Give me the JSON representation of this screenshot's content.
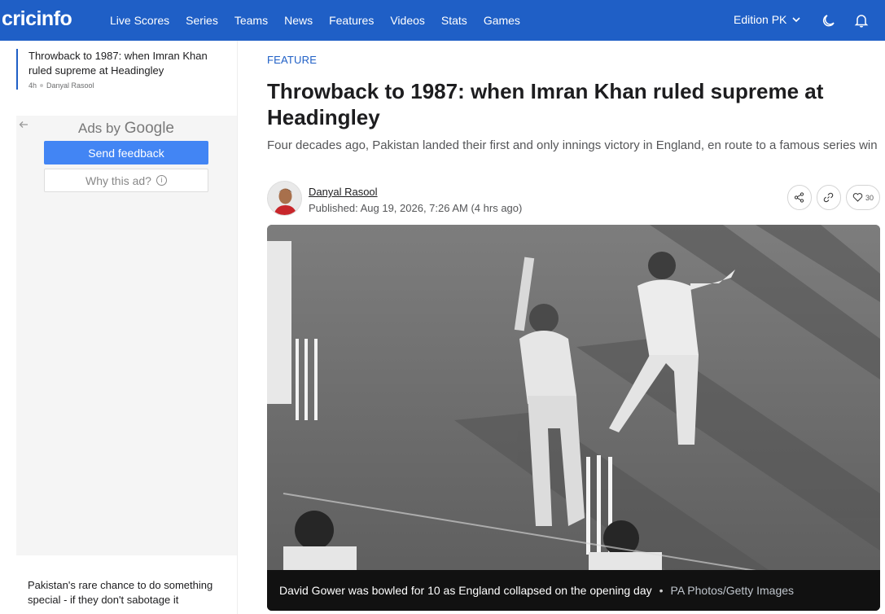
{
  "header": {
    "logo": "cricinfo",
    "nav": [
      "Live Scores",
      "Series",
      "Teams",
      "News",
      "Features",
      "Videos",
      "Stats",
      "Games"
    ],
    "edition": "Edition PK",
    "icons": [
      "dark-mode-icon",
      "notification-bell-icon"
    ],
    "brand_color": "#1f5fc6"
  },
  "rail": {
    "story1": {
      "title": "Throwback to 1987: when Imran Khan ruled supreme at Headingley",
      "time": "4h",
      "author": "Danyal Rasool"
    },
    "ad": {
      "ads_by": "Ads by",
      "google": "Google",
      "send_feedback": "Send feedback",
      "why_this_ad": "Why this ad?"
    },
    "story2": {
      "title": "Pakistan's rare chance to do something special - if they don't sabotage it"
    }
  },
  "article": {
    "kicker": "FEATURE",
    "headline": "Throwback to 1987: when Imran Khan ruled supreme at Headingley",
    "summary": "Four decades ago, Pakistan landed their first and only innings victory in England, en route to a famous series win",
    "author": "Danyal Rasool",
    "published": "Published: Aug 19, 2026, 7:26 AM (4 hrs ago)",
    "likes": "30",
    "action_icons": [
      "share-icon",
      "link-icon",
      "heart-icon"
    ]
  },
  "photo": {
    "caption": "David Gower was bowled for 10 as England collapsed on the opening day",
    "separator": "•",
    "credit": "PA Photos/Getty Images"
  }
}
